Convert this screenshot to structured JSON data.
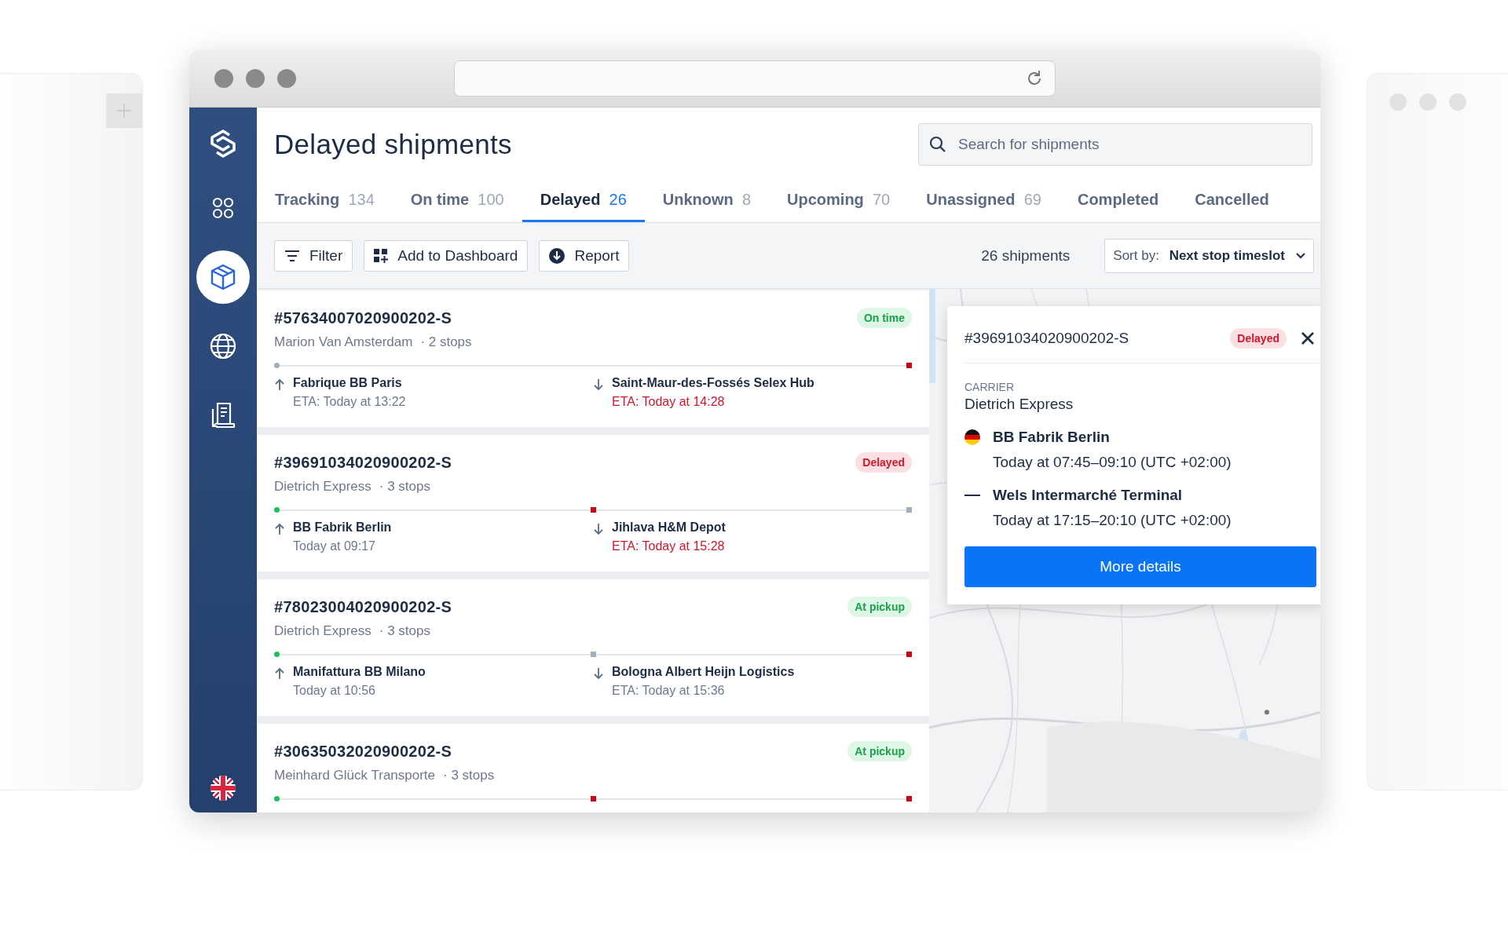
{
  "page": {
    "title": "Delayed shipments",
    "search": {
      "placeholder": "Search for shipments"
    }
  },
  "sidebar": {
    "items": [
      {
        "kind": "apps",
        "selected": false
      },
      {
        "kind": "box",
        "selected": true
      },
      {
        "kind": "globe",
        "selected": false
      },
      {
        "kind": "clipboard",
        "selected": false
      }
    ]
  },
  "tabs": [
    {
      "label": "Tracking",
      "count": "134",
      "selected": false
    },
    {
      "label": "On time",
      "count": "100",
      "selected": false
    },
    {
      "label": "Delayed",
      "count": "26",
      "selected": true
    },
    {
      "label": "Unknown",
      "count": "8",
      "selected": false
    },
    {
      "label": "Upcoming",
      "count": "70",
      "selected": false
    },
    {
      "label": "Unassigned",
      "count": "69",
      "selected": false
    },
    {
      "label": "Completed",
      "selected": false
    },
    {
      "label": "Cancelled",
      "selected": false
    }
  ],
  "toolbar": {
    "buttons": [
      {
        "kind": "filter",
        "label": "Filter"
      },
      {
        "kind": "dashboard",
        "label": "Add to Dashboard"
      },
      {
        "kind": "report",
        "label": "Report"
      }
    ],
    "count": "26 shipments",
    "sort_label": "Sort by:",
    "sort_value": "Next stop timeslot"
  },
  "shipments": [
    {
      "id": "#57634007020900202-S",
      "carrier": "Marion Van Amsterdam",
      "stops_count": "· 2 stops",
      "status": {
        "label": "On time",
        "kind": "ok"
      },
      "markers": [
        {
          "kind": "pending-dot"
        },
        {
          "kind": "late"
        }
      ],
      "stops": [
        {
          "kind": "pickup",
          "name": "Fabrique BB Paris",
          "time": "ETA: Today at 13:22",
          "late": false
        },
        {
          "kind": "dropoff",
          "name": "Saint-Maur-des-Fossés Selex Hub",
          "time": "ETA: Today at 14:28",
          "late": true
        }
      ]
    },
    {
      "id": "#39691034020900202-S",
      "carrier": "Dietrich Express",
      "stops_count": "· 3 stops",
      "status": {
        "label": "Delayed",
        "kind": "bad"
      },
      "markers": [
        {
          "kind": "done"
        },
        {
          "kind": "late"
        },
        {
          "kind": "pending"
        }
      ],
      "stops": [
        {
          "kind": "pickup",
          "name": "BB Fabrik Berlin",
          "time": "Today at 09:17",
          "late": false
        },
        {
          "kind": "dropoff",
          "name": "Jihlava H&M Depot",
          "time": "ETA: Today at 15:28",
          "late": true
        }
      ]
    },
    {
      "id": "#78023004020900202-S",
      "carrier": "Dietrich Express",
      "stops_count": "· 3 stops",
      "status": {
        "label": "At pickup",
        "kind": "ok"
      },
      "markers": [
        {
          "kind": "done"
        },
        {
          "kind": "pending"
        },
        {
          "kind": "late"
        }
      ],
      "stops": [
        {
          "kind": "pickup",
          "name": "Manifattura BB Milano",
          "time": "Today at 10:56",
          "late": false
        },
        {
          "kind": "dropoff",
          "name": "Bologna Albert Heijn Logistics",
          "time": "ETA: Today at 15:36",
          "late": false
        }
      ]
    },
    {
      "id": "#30635032020900202-S",
      "carrier": "Meinhard Glück Transporte",
      "stops_count": "· 3 stops",
      "status": {
        "label": "At pickup",
        "kind": "ok"
      },
      "markers": [
        {
          "kind": "done"
        },
        {
          "kind": "late"
        },
        {
          "kind": "late"
        }
      ]
    }
  ],
  "popup": {
    "id": "#39691034020900202-S",
    "status": {
      "label": "Delayed",
      "kind": "bad"
    },
    "carrier_label": "CARRIER",
    "carrier": "Dietrich Express",
    "stops": [
      {
        "kind": "flag",
        "name": "BB Fabrik Berlin",
        "time": "Today at 07:45–09:10 (UTC +02:00)"
      },
      {
        "kind": "dash",
        "name": "Wels Intermarché Terminal",
        "time": "Today at 17:15–20:10 (UTC +02:00)"
      }
    ],
    "button": "More details"
  }
}
